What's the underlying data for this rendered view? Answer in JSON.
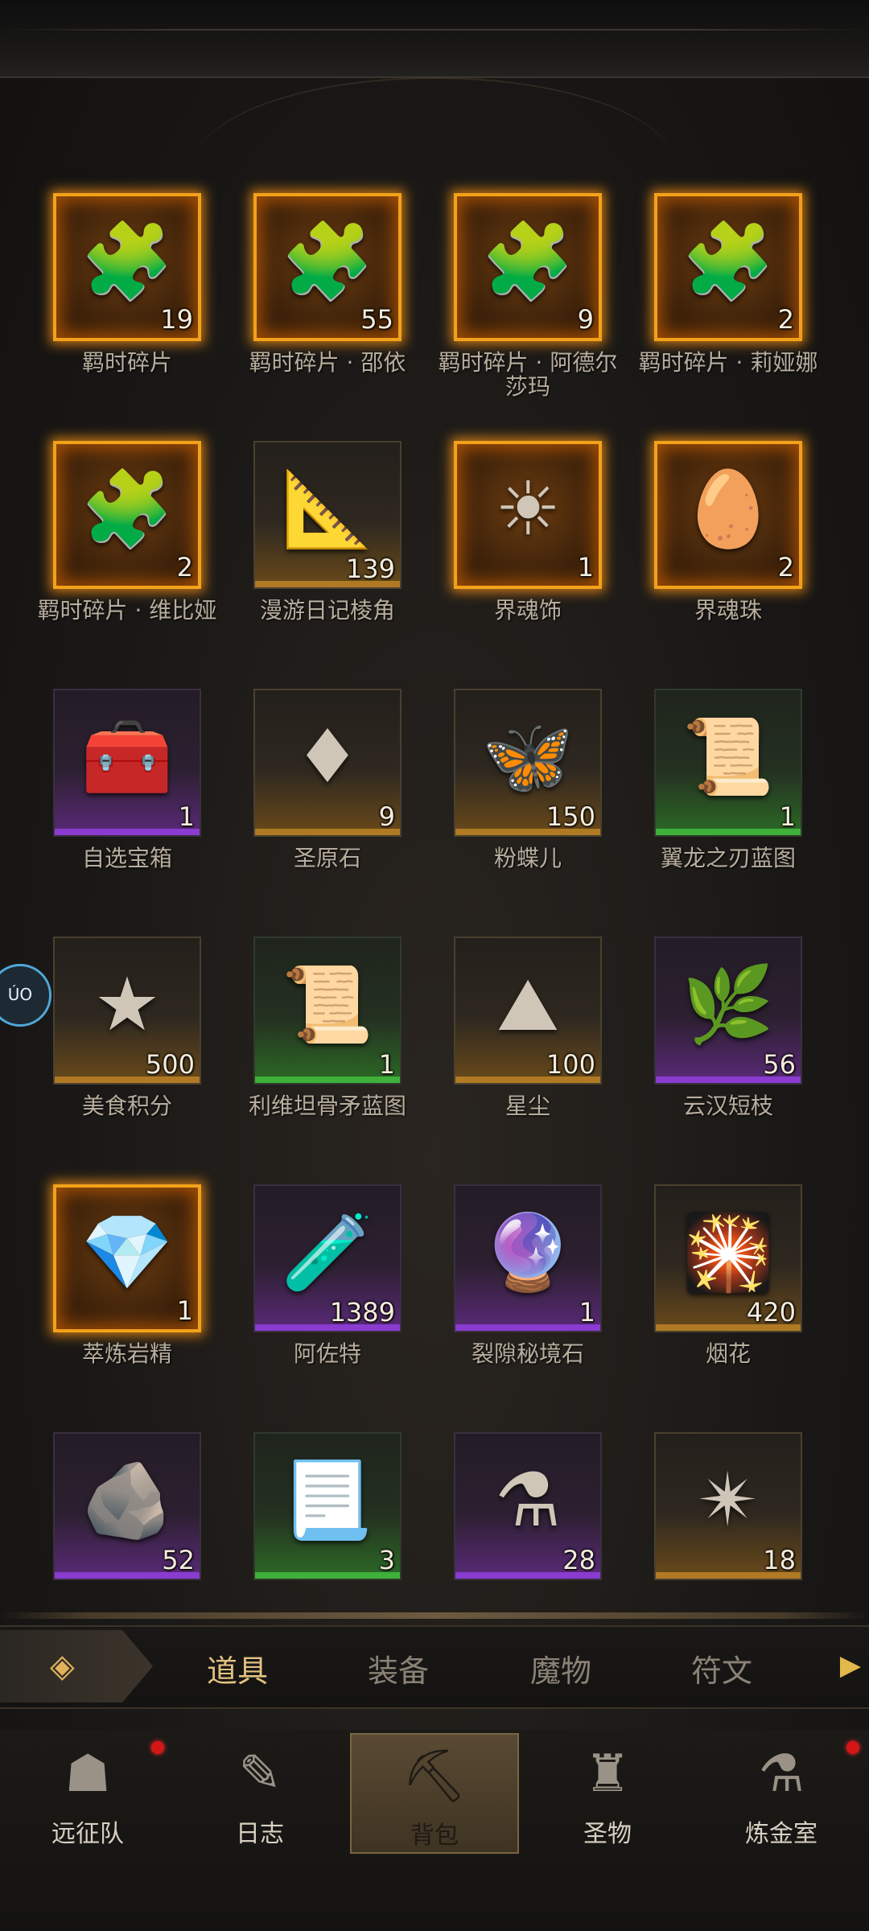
{
  "items": [
    {
      "name": "羁时碎片",
      "count": "19",
      "rarity": "legend",
      "icon": "puzzle-icon",
      "glyph": "🧩"
    },
    {
      "name": "羁时碎片 · 邵依",
      "count": "55",
      "rarity": "legend",
      "icon": "puzzle-icon",
      "glyph": "🧩"
    },
    {
      "name": "羁时碎片 · 阿德尔莎玛",
      "count": "9",
      "rarity": "legend",
      "icon": "puzzle-icon",
      "glyph": "🧩"
    },
    {
      "name": "羁时碎片 · 莉娅娜",
      "count": "2",
      "rarity": "legend",
      "icon": "puzzle-icon",
      "glyph": "🧩"
    },
    {
      "name": "羁时碎片 · 维比娅",
      "count": "2",
      "rarity": "legend",
      "icon": "puzzle-icon",
      "glyph": "🧩"
    },
    {
      "name": "漫游日记棱角",
      "count": "139",
      "rarity": "gold",
      "icon": "book-corner-icon",
      "glyph": "📐"
    },
    {
      "name": "界魂饰",
      "count": "1",
      "rarity": "legend",
      "icon": "sun-mask-icon",
      "glyph": "☀"
    },
    {
      "name": "界魂珠",
      "count": "2",
      "rarity": "legend",
      "icon": "orb-icon",
      "glyph": "🥚"
    },
    {
      "name": "自选宝箱",
      "count": "1",
      "rarity": "epic",
      "icon": "chest-icon",
      "glyph": "🧰"
    },
    {
      "name": "圣原石",
      "count": "9",
      "rarity": "gold",
      "icon": "ruby-icon",
      "glyph": "♦"
    },
    {
      "name": "粉蝶儿",
      "count": "150",
      "rarity": "gold",
      "icon": "butterfly-icon",
      "glyph": "🦋"
    },
    {
      "name": "翼龙之刃蓝图",
      "count": "1",
      "rarity": "rare",
      "icon": "scroll-icon",
      "glyph": "📜"
    },
    {
      "name": "美食积分",
      "count": "500",
      "rarity": "gold",
      "icon": "star-icon",
      "glyph": "★"
    },
    {
      "name": "利维坦骨矛蓝图",
      "count": "1",
      "rarity": "rare",
      "icon": "scroll-icon",
      "glyph": "📜"
    },
    {
      "name": "星尘",
      "count": "100",
      "rarity": "gold",
      "icon": "dust-pile-icon",
      "glyph": "⛰"
    },
    {
      "name": "云汉短枝",
      "count": "56",
      "rarity": "epic",
      "icon": "branch-icon",
      "glyph": "🌿"
    },
    {
      "name": "萃炼岩精",
      "count": "1",
      "rarity": "legend",
      "icon": "crystal-icon",
      "glyph": "💎"
    },
    {
      "name": "阿佐特",
      "count": "1389",
      "rarity": "epic",
      "icon": "vial-icon",
      "glyph": "🧪"
    },
    {
      "name": "裂隙秘境石",
      "count": "1",
      "rarity": "epic",
      "icon": "amethyst-icon",
      "glyph": "🔮"
    },
    {
      "name": "烟花",
      "count": "420",
      "rarity": "gold",
      "icon": "firework-icon",
      "glyph": "🎇"
    },
    {
      "name": "",
      "count": "52",
      "rarity": "epic",
      "icon": "rune-stone-icon",
      "glyph": "🪨"
    },
    {
      "name": "",
      "count": "3",
      "rarity": "rare",
      "icon": "parchment-icon",
      "glyph": "📃"
    },
    {
      "name": "",
      "count": "28",
      "rarity": "epic",
      "icon": "potion-icon",
      "glyph": "⚗"
    },
    {
      "name": "",
      "count": "18",
      "rarity": "gold",
      "icon": "glowing-stone-icon",
      "glyph": "✴"
    }
  ],
  "tabs": {
    "back_glyph": "◈",
    "items": [
      {
        "label": "道具",
        "active": true
      },
      {
        "label": "装备",
        "active": false
      },
      {
        "label": "魔物",
        "active": false
      },
      {
        "label": "符文",
        "active": false
      }
    ],
    "more_glyph": "▶"
  },
  "nav": [
    {
      "label": "远征队",
      "glyph": "☗",
      "icon": "helmet-icon",
      "badge": true
    },
    {
      "label": "日志",
      "glyph": "✎",
      "icon": "journal-icon",
      "badge": false
    },
    {
      "label": "背包",
      "glyph": "⛏",
      "icon": "backpack-icon",
      "badge": false,
      "active": true
    },
    {
      "label": "圣物",
      "glyph": "♜",
      "icon": "chalice-icon",
      "badge": false
    },
    {
      "label": "炼金室",
      "glyph": "⚗",
      "icon": "alchemy-icon",
      "badge": true
    }
  ],
  "side_bubble": "ÚO"
}
